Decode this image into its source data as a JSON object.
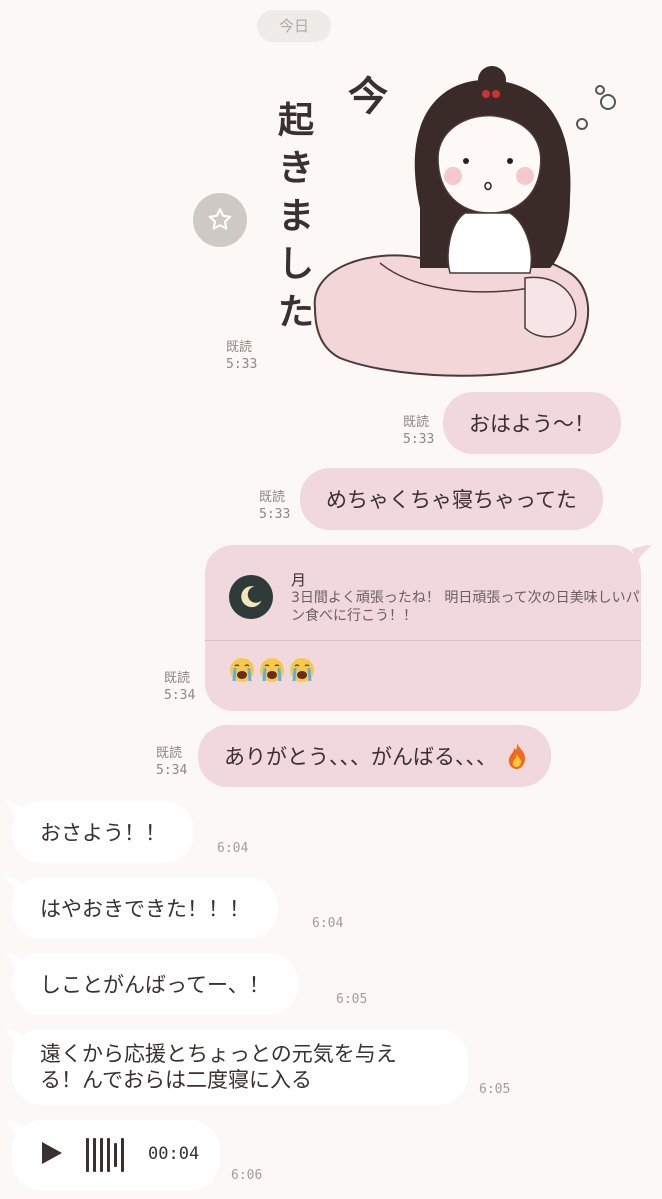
{
  "date_label": "今日",
  "sticker": {
    "icon": "sleepy-girl-sticker",
    "text_lines": [
      "今",
      "起きました"
    ]
  },
  "sticker_meta": {
    "read": "既読",
    "time": "5:33"
  },
  "outgoing": [
    {
      "text": "おはよう〜！",
      "read": "既読",
      "time": "5:33"
    },
    {
      "text": "めちゃくちゃ寝ちゃってた",
      "read": "既読",
      "time": "5:33"
    }
  ],
  "reply_card": {
    "sender": "月",
    "quoted_text": "3日間よく頑張ったね！ 明日頑張って次の日美味しいパン食べに行こう！！",
    "emoji_count": 3,
    "emoji_icon": "loudly-crying-face",
    "read": "既読",
    "time": "5:34"
  },
  "outgoing_after": {
    "text": "ありがとう、、、がんばる、、、",
    "trailing_icon": "fire-icon",
    "read": "既読",
    "time": "5:34"
  },
  "incoming": [
    {
      "text": "おさよう！！",
      "time": "6:04"
    },
    {
      "text": "はやおきできた！！！",
      "time": "6:04"
    },
    {
      "text": "しことがんばってー、！",
      "time": "6:05"
    },
    {
      "line1": "遠くから応援とちょっとの元気を与え",
      "line2": "る！んでおらは二度寝に入る",
      "time": "6:05"
    }
  ],
  "voice_message": {
    "duration": "00:04",
    "time": "6:06"
  },
  "colors": {
    "background": "#fcf8f5",
    "outgoing_bubble": "#f0d8dc",
    "incoming_bubble": "#ffffff"
  }
}
